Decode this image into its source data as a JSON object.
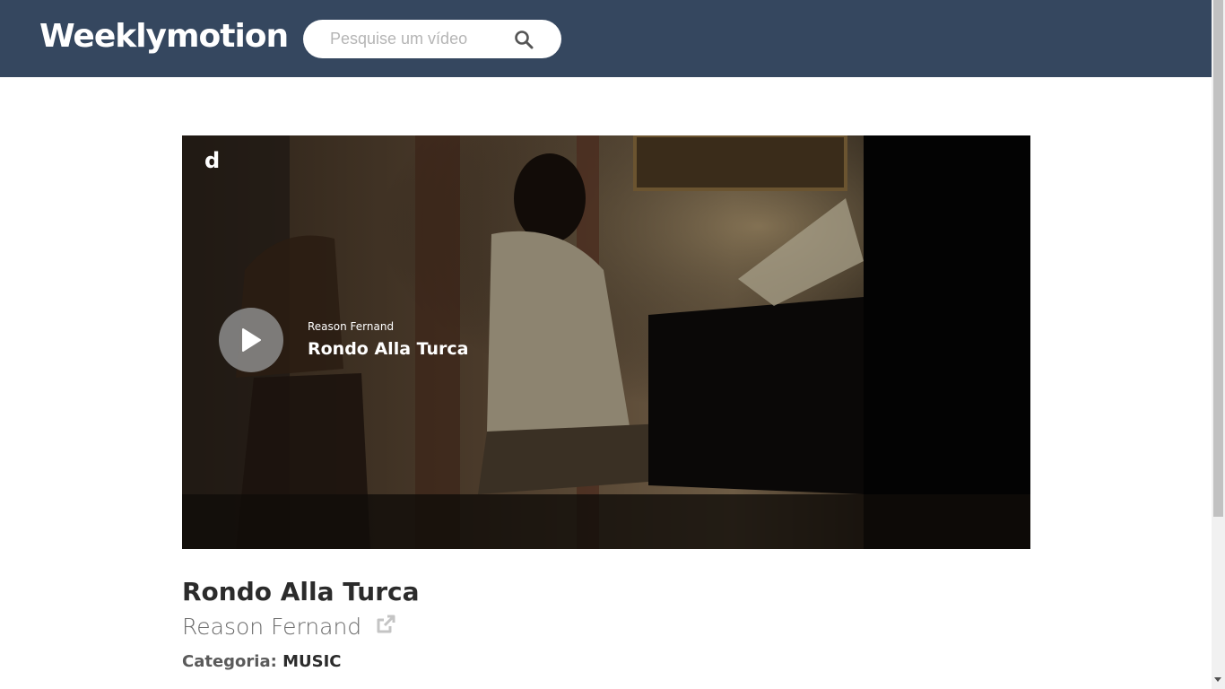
{
  "header": {
    "brand": "Weeklymotion",
    "search_placeholder": "Pesquise um vídeo",
    "search_icon": "search-icon"
  },
  "player": {
    "logo": "d",
    "channel": "Reason Fernand",
    "title": "Rondo Alla Turca",
    "play_icon": "play-icon"
  },
  "video": {
    "title": "Rondo Alla Turca",
    "channel": "Reason Fernand",
    "external_icon": "external-link-icon",
    "category_label": "Categoria:",
    "category_value": "MUSIC"
  },
  "colors": {
    "header_bg": "#35475f",
    "icon_gray": "#c4c4c4"
  }
}
